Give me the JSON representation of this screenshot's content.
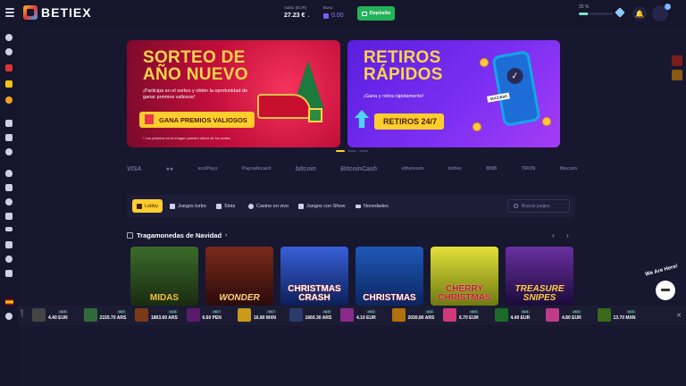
{
  "header": {
    "logo": "BETIEX",
    "balance_label": "Saldo (EUR)",
    "balance_value": "27.23 €",
    "bonus_label": "Bono",
    "bonus_value": "0.00",
    "deposit_label": "Depósito",
    "level_pct": "25 %",
    "level_fraction": 0.25
  },
  "banners": [
    {
      "title": "SORTEO DE AÑO NUEVO",
      "subtitle": "¡Participa en el sorteo y obtén la oportunidad de ganar premios valiosos!",
      "cta": "GANA PREMIOS VALIOSOS",
      "note": "* Los premios en la imagen pueden diferir de los reales"
    },
    {
      "title": "RETIROS RÁPIDOS",
      "subtitle": "¡Gana y retira rápidamente!",
      "cta": "RETIROS 24/7",
      "phone_label": "SUCCESS"
    }
  ],
  "payments": [
    "VISA",
    "●●",
    "ecoPayz",
    "Paysafecard",
    "bitcoin",
    "BitcoinCash",
    "ethereum",
    "tether",
    "BNB",
    "TRON",
    "litecoin"
  ],
  "tabs": {
    "lobby": "Lobby",
    "turbo": "Juegos turbo",
    "slots": "Slots",
    "casino": "Casino en vivo",
    "show": "Juegos con Show",
    "news": "Novedades",
    "search_placeholder": "Buscar juegos"
  },
  "section": {
    "title": "Tragamonedas de Navidad",
    "games": [
      {
        "name": "MIDAS",
        "color": "#2a4a1e"
      },
      {
        "name": "Wonder",
        "color": "#5a1a1a"
      },
      {
        "name": "CHRISTMAS CRASH",
        "color": "#1d3a8a"
      },
      {
        "name": "CHRISTMAS",
        "color": "#0f3c7a"
      },
      {
        "name": "CHERRY CHRISTMAS",
        "color": "#c9c21a"
      },
      {
        "name": "Treasure SNIPES",
        "color": "#3c1f6b"
      }
    ]
  },
  "ticker": {
    "live": "LIVE",
    "items": [
      {
        "mult": "x5.5",
        "amt": "4.40 EUR"
      },
      {
        "mult": "x8.9",
        "amt": "2155.70 ARS"
      },
      {
        "mult": "x4.8",
        "amt": "1863.60 ARS"
      },
      {
        "mult": "x6.7",
        "amt": "6.60 PEN"
      },
      {
        "mult": "x5.7",
        "amt": "16.80 MXN"
      },
      {
        "mult": "x4.8",
        "amt": "1660.30 ARS"
      },
      {
        "mult": "x5.5",
        "amt": "4.10 EUR"
      },
      {
        "mult": "x4.8",
        "amt": "2030.80 ARS"
      },
      {
        "mult": "x5.5",
        "amt": "6.70 EUR"
      },
      {
        "mult": "x4.8",
        "amt": "4.40 EUR"
      },
      {
        "mult": "x5.5",
        "amt": "4.80 EUR"
      },
      {
        "mult": "x4.3",
        "amt": "13.70 MXN"
      }
    ]
  },
  "chat": {
    "bubble_text": "We Are Here!"
  }
}
